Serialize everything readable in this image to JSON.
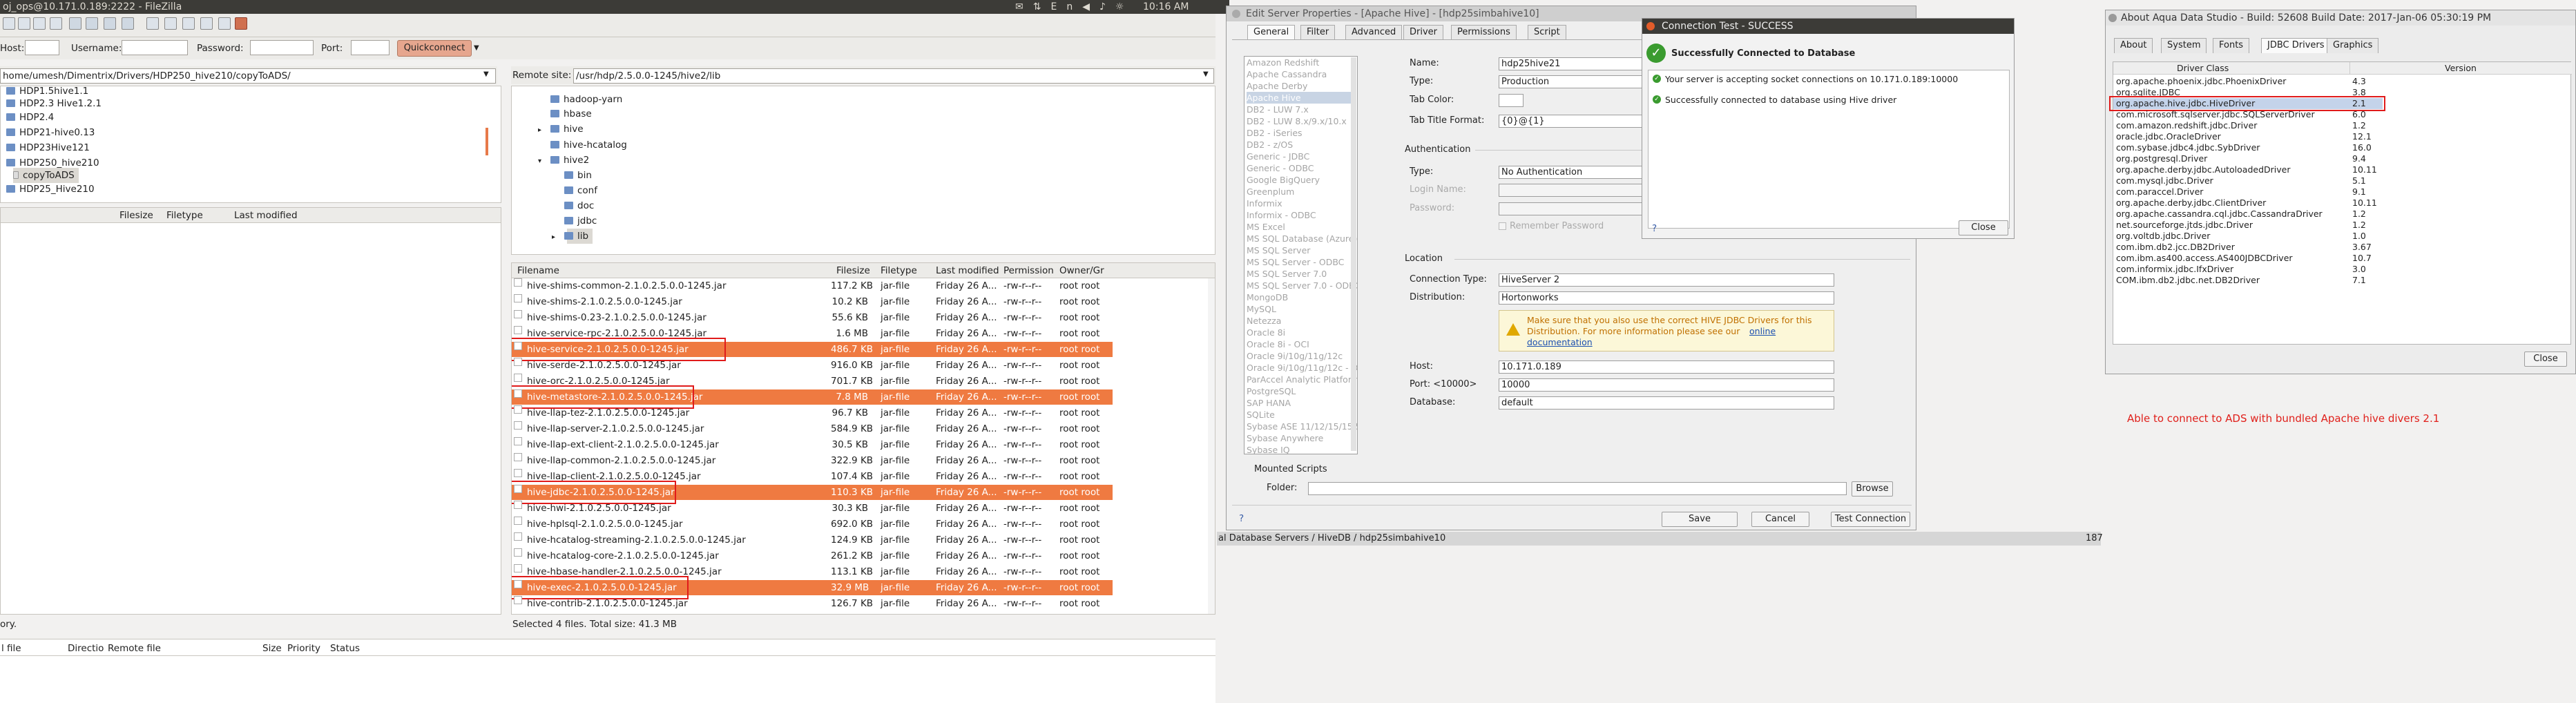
{
  "topbar": {
    "title": "oj_ops@10.171.0.189:2222 - FileZilla",
    "icons": [
      "✉",
      "⇅",
      "En",
      "◀♪",
      "☼"
    ],
    "clock": "10:16 AM"
  },
  "quickconnect": {
    "host_label": "Host:",
    "host_value": "",
    "username_label": "Username:",
    "password_label": "Password:",
    "port_label": "Port:",
    "button_label": "Quickconnect"
  },
  "local": {
    "path": "home/umesh/Dimentrix/Drivers/HDP250_hive210/copyToADS/",
    "tree": [
      {
        "label": "HDP1.5hive1.1"
      },
      {
        "label": "HDP2.3 Hive1.2.1"
      },
      {
        "label": "HDP2.4"
      },
      {
        "label": "HDP21-hive0.13"
      },
      {
        "label": "HDP23Hive121"
      },
      {
        "label": "HDP250_hive210"
      },
      {
        "label": "copyToADS",
        "selected": true
      },
      {
        "label": "HDP25_Hive210"
      }
    ],
    "columns": [
      "Filesize",
      "Filetype",
      "Last modified"
    ],
    "status": "ory."
  },
  "remote": {
    "site_label": "Remote site:",
    "path": "/usr/hdp/2.5.0.0-1245/hive2/lib",
    "tree": [
      {
        "label": "hadoop-yarn",
        "expander": ""
      },
      {
        "label": "hbase",
        "expander": ""
      },
      {
        "label": "hive",
        "expander": "▸"
      },
      {
        "label": "hive-hcatalog",
        "expander": ""
      },
      {
        "label": "hive2",
        "expander": "▾"
      },
      {
        "label": "bin",
        "expander": ""
      },
      {
        "label": "conf",
        "expander": ""
      },
      {
        "label": "doc",
        "expander": ""
      },
      {
        "label": "jdbc",
        "expander": ""
      },
      {
        "label": "lib",
        "expander": "▸",
        "selected": true
      }
    ],
    "columns": [
      "Filename",
      "Filesize",
      "Filetype",
      "Last modified",
      "Permission",
      "Owner/Gr"
    ],
    "files": [
      {
        "name": "hive-shims-common-2.1.0.2.5.0.0-1245.jar",
        "size": "117.2 KB",
        "type": "jar-file",
        "modified": "Friday 26 A...",
        "perm": "-rw-r--r--",
        "owner": "root root",
        "hl": false
      },
      {
        "name": "hive-shims-2.1.0.2.5.0.0-1245.jar",
        "size": "10.2 KB",
        "type": "jar-file",
        "modified": "Friday 26 A...",
        "perm": "-rw-r--r--",
        "owner": "root root",
        "hl": false
      },
      {
        "name": "hive-shims-0.23-2.1.0.2.5.0.0-1245.jar",
        "size": "55.6 KB",
        "type": "jar-file",
        "modified": "Friday 26 A...",
        "perm": "-rw-r--r--",
        "owner": "root root",
        "hl": false
      },
      {
        "name": "hive-service-rpc-2.1.0.2.5.0.0-1245.jar",
        "size": "1.6 MB",
        "type": "jar-file",
        "modified": "Friday 26 A...",
        "perm": "-rw-r--r--",
        "owner": "root root",
        "hl": false
      },
      {
        "name": "hive-service-2.1.0.2.5.0.0-1245.jar",
        "size": "486.7 KB",
        "type": "jar-file",
        "modified": "Friday 26 A...",
        "perm": "-rw-r--r--",
        "owner": "root root",
        "hl": true
      },
      {
        "name": "hive-serde-2.1.0.2.5.0.0-1245.jar",
        "size": "916.0 KB",
        "type": "jar-file",
        "modified": "Friday 26 A...",
        "perm": "-rw-r--r--",
        "owner": "root root",
        "hl": false
      },
      {
        "name": "hive-orc-2.1.0.2.5.0.0-1245.jar",
        "size": "701.7 KB",
        "type": "jar-file",
        "modified": "Friday 26 A...",
        "perm": "-rw-r--r--",
        "owner": "root root",
        "hl": false
      },
      {
        "name": "hive-metastore-2.1.0.2.5.0.0-1245.jar",
        "size": "7.8 MB",
        "type": "jar-file",
        "modified": "Friday 26 A...",
        "perm": "-rw-r--r--",
        "owner": "root root",
        "hl": true
      },
      {
        "name": "hive-llap-tez-2.1.0.2.5.0.0-1245.jar",
        "size": "96.7 KB",
        "type": "jar-file",
        "modified": "Friday 26 A...",
        "perm": "-rw-r--r--",
        "owner": "root root",
        "hl": false
      },
      {
        "name": "hive-llap-server-2.1.0.2.5.0.0-1245.jar",
        "size": "584.9 KB",
        "type": "jar-file",
        "modified": "Friday 26 A...",
        "perm": "-rw-r--r--",
        "owner": "root root",
        "hl": false
      },
      {
        "name": "hive-llap-ext-client-2.1.0.2.5.0.0-1245.jar",
        "size": "30.5 KB",
        "type": "jar-file",
        "modified": "Friday 26 A...",
        "perm": "-rw-r--r--",
        "owner": "root root",
        "hl": false
      },
      {
        "name": "hive-llap-common-2.1.0.2.5.0.0-1245.jar",
        "size": "322.9 KB",
        "type": "jar-file",
        "modified": "Friday 26 A...",
        "perm": "-rw-r--r--",
        "owner": "root root",
        "hl": false
      },
      {
        "name": "hive-llap-client-2.1.0.2.5.0.0-1245.jar",
        "size": "107.4 KB",
        "type": "jar-file",
        "modified": "Friday 26 A...",
        "perm": "-rw-r--r--",
        "owner": "root root",
        "hl": false
      },
      {
        "name": "hive-jdbc-2.1.0.2.5.0.0-1245.jar",
        "size": "110.3 KB",
        "type": "jar-file",
        "modified": "Friday 26 A...",
        "perm": "-rw-r--r--",
        "owner": "root root",
        "hl": true
      },
      {
        "name": "hive-hwi-2.1.0.2.5.0.0-1245.jar",
        "size": "30.3 KB",
        "type": "jar-file",
        "modified": "Friday 26 A...",
        "perm": "-rw-r--r--",
        "owner": "root root",
        "hl": false
      },
      {
        "name": "hive-hplsql-2.1.0.2.5.0.0-1245.jar",
        "size": "692.0 KB",
        "type": "jar-file",
        "modified": "Friday 26 A...",
        "perm": "-rw-r--r--",
        "owner": "root root",
        "hl": false
      },
      {
        "name": "hive-hcatalog-streaming-2.1.0.2.5.0.0-1245.jar",
        "size": "124.9 KB",
        "type": "jar-file",
        "modified": "Friday 26 A...",
        "perm": "-rw-r--r--",
        "owner": "root root",
        "hl": false
      },
      {
        "name": "hive-hcatalog-core-2.1.0.2.5.0.0-1245.jar",
        "size": "261.2 KB",
        "type": "jar-file",
        "modified": "Friday 26 A...",
        "perm": "-rw-r--r--",
        "owner": "root root",
        "hl": false
      },
      {
        "name": "hive-hbase-handler-2.1.0.2.5.0.0-1245.jar",
        "size": "113.1 KB",
        "type": "jar-file",
        "modified": "Friday 26 A...",
        "perm": "-rw-r--r--",
        "owner": "root root",
        "hl": false
      },
      {
        "name": "hive-exec-2.1.0.2.5.0.0-1245.jar",
        "size": "32.9 MB",
        "type": "jar-file",
        "modified": "Friday 26 A...",
        "perm": "-rw-r--r--",
        "owner": "root root",
        "hl": true
      },
      {
        "name": "hive-contrib-2.1.0.2.5.0.0-1245.jar",
        "size": "126.7 KB",
        "type": "jar-file",
        "modified": "Friday 26 A...",
        "perm": "-rw-r--r--",
        "owner": "root root",
        "hl": false
      }
    ],
    "status": "Selected 4 files. Total size: 41.3 MB"
  },
  "queue": {
    "columns": [
      "l file",
      "Directio",
      "Remote file",
      "Size",
      "Priority",
      "Status"
    ]
  },
  "server_props": {
    "title": "Edit Server Properties - [Apache Hive] - [hdp25simbahive10]",
    "tabs": [
      "General",
      "Filter",
      "Advanced",
      "Driver",
      "Permissions",
      "Script"
    ],
    "drivers": [
      "Amazon Redshift",
      "Apache Cassandra",
      "Apache Derby",
      "Apache Hive",
      "DB2 - LUW 7.x",
      "DB2 - LUW 8.x/9.x/10.x",
      "DB2 - iSeries",
      "DB2 - z/OS",
      "Generic - JDBC",
      "Generic - ODBC",
      "Google BigQuery",
      "Greenplum",
      "Informix",
      "Informix - ODBC",
      "MS Excel",
      "MS SQL Database (Azure)",
      "MS SQL Server",
      "MS SQL Server - ODBC",
      "MS SQL Server 7.0",
      "MS SQL Server 7.0 - ODBC",
      "MongoDB",
      "MySQL",
      "Netezza",
      "Oracle 8i",
      "Oracle 8i - OCI",
      "Oracle 9i/10g/11g/12c",
      "Oracle 9i/10g/11g/12c - OCI",
      "ParAccel Analytic Platform",
      "PostgreSQL",
      "SAP HANA",
      "SQLite",
      "Sybase ASE 11/12/15/15.5",
      "Sybase Anywhere",
      "Sybase IQ"
    ],
    "selected_driver_index": 3,
    "name_label": "Name:",
    "name_value": "hdp25hive21",
    "type_label": "Type:",
    "type_value": "Production",
    "tabcolor_label": "Tab Color:",
    "tabtitle_label": "Tab Title Format:",
    "tabtitle_value": "{0}@{1}",
    "auth_section": "Authentication",
    "authtype_label": "Type:",
    "authtype_value": "No Authentication",
    "login_label": "Login Name:",
    "password_label": "Password:",
    "remember_label": "Remember Password",
    "location_section": "Location",
    "conntype_label": "Connection Type:",
    "conntype_value": "HiveServer 2",
    "dist_label": "Distribution:",
    "dist_value": "Hortonworks",
    "warning_text_1": "Make sure that you also use the correct HIVE JDBC Drivers for this",
    "warning_text_2": "Distribution. For more information please see our",
    "warning_link_1": "online",
    "warning_link_2": "documentation",
    "host_label": "Host:",
    "host_value": "10.171.0.189",
    "port_label": "Port: <10000>",
    "port_value": "10000",
    "db_label": "Database:",
    "db_value": "default",
    "mounted_section": "Mounted Scripts",
    "folder_label": "Folder:",
    "browse_label": "Browse",
    "save_label": "Save",
    "cancel_label": "Cancel",
    "test_label": "Test Connection",
    "status": "al Database Servers / HiveDB / hdp25simbahive10"
  },
  "conn_test": {
    "title": "Connection Test - SUCCESS",
    "heading": "Successfully Connected to Database",
    "msg1": "Your server is accepting socket connections on 10.171.0.189:10000",
    "msg2": "Successfully connected to database using Hive driver",
    "close_label": "Close"
  },
  "about": {
    "title": "About Aqua Data Studio - Build: 52608 Build Date: 2017-Jan-06 05:30:19 PM",
    "tabs": [
      "About",
      "System",
      "Fonts",
      "JDBC Drivers",
      "Graphics"
    ],
    "columns": [
      "Driver Class",
      "Version"
    ],
    "rows": [
      {
        "cls": "org.apache.phoenix.jdbc.PhoenixDriver",
        "ver": "4.3"
      },
      {
        "cls": "org.sqlite.JDBC",
        "ver": "3.8"
      },
      {
        "cls": "org.apache.hive.jdbc.HiveDriver",
        "ver": "2.1",
        "selected": true
      },
      {
        "cls": "com.microsoft.sqlserver.jdbc.SQLServerDriver",
        "ver": "6.0"
      },
      {
        "cls": "com.amazon.redshift.jdbc.Driver",
        "ver": "1.2"
      },
      {
        "cls": "oracle.jdbc.OracleDriver",
        "ver": "12.1"
      },
      {
        "cls": "com.sybase.jdbc4.jdbc.SybDriver",
        "ver": "16.0"
      },
      {
        "cls": "org.postgresql.Driver",
        "ver": "9.4"
      },
      {
        "cls": "org.apache.derby.jdbc.AutoloadedDriver",
        "ver": "10.11"
      },
      {
        "cls": "com.mysql.jdbc.Driver",
        "ver": "5.1"
      },
      {
        "cls": "com.paraccel.Driver",
        "ver": "9.1"
      },
      {
        "cls": "org.apache.derby.jdbc.ClientDriver",
        "ver": "10.11"
      },
      {
        "cls": "org.apache.cassandra.cql.jdbc.CassandraDriver",
        "ver": "1.2"
      },
      {
        "cls": "net.sourceforge.jtds.jdbc.Driver",
        "ver": "1.2"
      },
      {
        "cls": "org.voltdb.jdbc.Driver",
        "ver": "1.0"
      },
      {
        "cls": "com.ibm.db2.jcc.DB2Driver",
        "ver": "3.67"
      },
      {
        "cls": "com.ibm.as400.access.AS400JDBCDriver",
        "ver": "10.7"
      },
      {
        "cls": "com.informix.jdbc.IfxDriver",
        "ver": "3.0"
      },
      {
        "cls": "COM.ibm.db2.jdbc.net.DB2Driver",
        "ver": "7.1"
      }
    ],
    "close_label": "Close"
  },
  "annotation": "Able to connect to ADS with bundled Apache hive divers 2.1",
  "right_edge_number": "187"
}
